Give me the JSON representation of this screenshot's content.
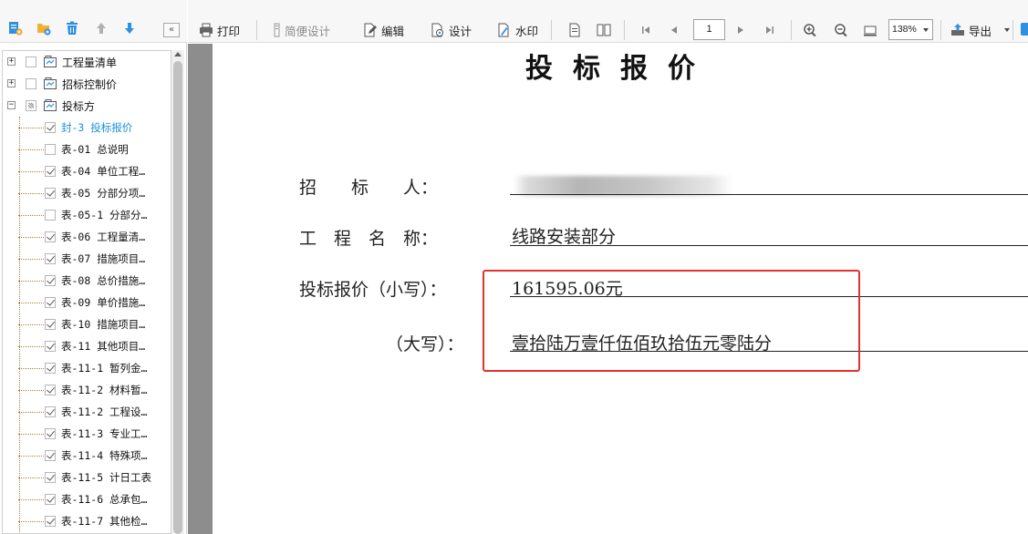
{
  "left_panel": {
    "tree": [
      {
        "label": "工程量清单",
        "type": "folder",
        "expander": "+",
        "checked": false
      },
      {
        "label": "招标控制价",
        "type": "folder",
        "expander": "+",
        "checked": false
      },
      {
        "label": "投标方",
        "type": "folder",
        "expander": "−",
        "checked": "partial"
      },
      {
        "label": "封-3 投标报价",
        "type": "leaf",
        "checked": true,
        "selected": true
      },
      {
        "label": "表-01 总说明",
        "type": "leaf",
        "checked": false
      },
      {
        "label": "表-04 单位工程…",
        "type": "leaf",
        "checked": true
      },
      {
        "label": "表-05 分部分项…",
        "type": "leaf",
        "checked": true
      },
      {
        "label": "表-05-1 分部分…",
        "type": "leaf",
        "checked": false
      },
      {
        "label": "表-06 工程量清…",
        "type": "leaf",
        "checked": true
      },
      {
        "label": "表-07 措施项目…",
        "type": "leaf",
        "checked": true
      },
      {
        "label": "表-08 总价措施…",
        "type": "leaf",
        "checked": true
      },
      {
        "label": "表-09 单价措施…",
        "type": "leaf",
        "checked": true
      },
      {
        "label": "表-10 措施项目…",
        "type": "leaf",
        "checked": true
      },
      {
        "label": "表-11 其他项目…",
        "type": "leaf",
        "checked": true
      },
      {
        "label": "表-11-1 暂列金…",
        "type": "leaf",
        "checked": true
      },
      {
        "label": "表-11-2 材料暂…",
        "type": "leaf",
        "checked": true
      },
      {
        "label": "表-11-2 工程设…",
        "type": "leaf",
        "checked": true
      },
      {
        "label": "表-11-3 专业工…",
        "type": "leaf",
        "checked": true
      },
      {
        "label": "表-11-4 特殊项…",
        "type": "leaf",
        "checked": true
      },
      {
        "label": "表-11-5 计日工表",
        "type": "leaf",
        "checked": true
      },
      {
        "label": "表-11-6 总承包…",
        "type": "leaf",
        "checked": true
      },
      {
        "label": "表-11-7 其他检…",
        "type": "leaf",
        "checked": true
      }
    ],
    "collapse_label": "«"
  },
  "toolbar": {
    "print": "打印",
    "simple_design": "简便设计",
    "edit": "编辑",
    "design": "设计",
    "watermark": "水印",
    "page": "1",
    "zoom": "138%",
    "export": "导出"
  },
  "document": {
    "title": "投标报价",
    "fields": {
      "tenderer_label": "招　　标　　人：",
      "project_label": "工　程　名　称：",
      "project_value": "线路安装部分",
      "price_small_label": "投标报价（小写）：",
      "price_small_value": "161595.06元",
      "price_big_label": "（大写）：",
      "price_big_value": "壹拾陆万壹仟伍佰玖拾伍元零陆分"
    }
  },
  "colors": {
    "accent": "#1a8fdd",
    "highlight": "#e53030",
    "doc_background": "#8d8d8d"
  }
}
